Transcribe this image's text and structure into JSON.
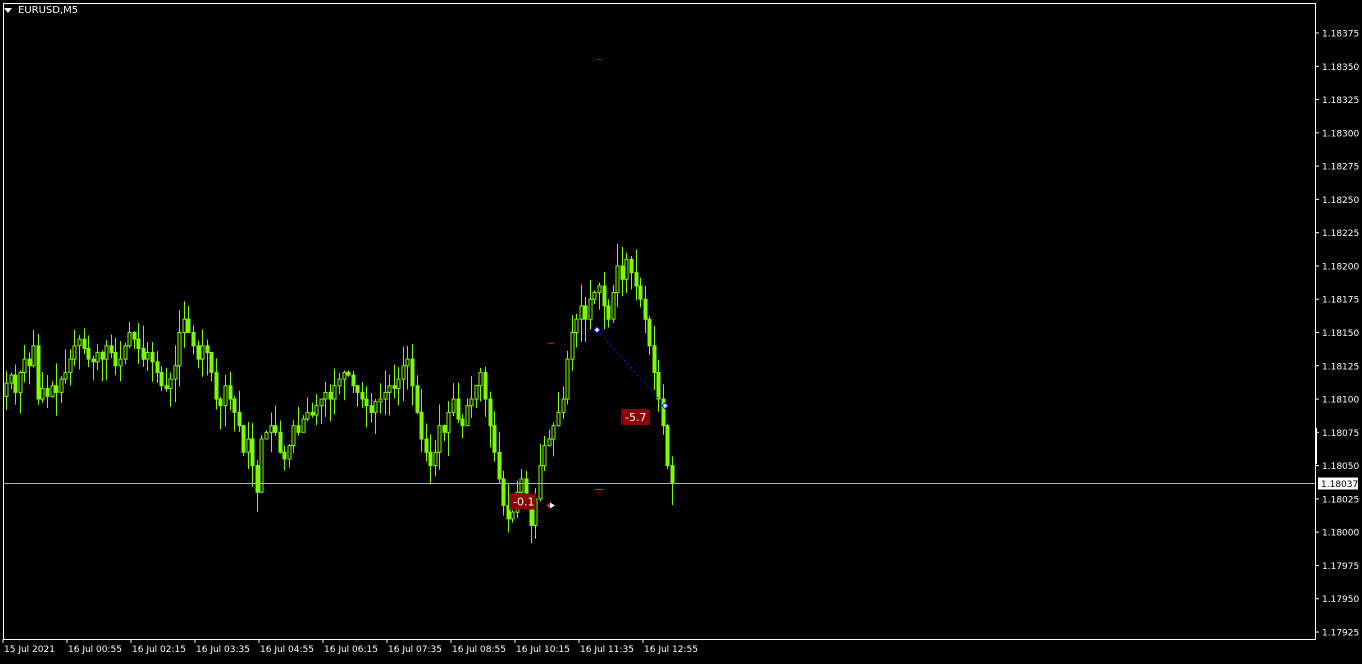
{
  "window": {
    "symbol_title": "EURUSD,M5"
  },
  "icons": {
    "menu": "triangle-down-icon"
  },
  "colors": {
    "background": "#000000",
    "frame": "#ffffff",
    "axis_text": "#ffffff",
    "bull_candle": "#7cfc00",
    "bear_candle": "#7cfc00",
    "bid_line": "#a8b4c0",
    "trade_line": "#1b1bff",
    "profit_badge": "#8b0000",
    "marker_red": "#ff2020"
  },
  "price_axis": {
    "min": 1.1791,
    "max": 1.1839,
    "ticks": [
      "1.18375",
      "1.18350",
      "1.18325",
      "1.18300",
      "1.18275",
      "1.18250",
      "1.18225",
      "1.18200",
      "1.18175",
      "1.18150",
      "1.18125",
      "1.18100",
      "1.18075",
      "1.18050",
      "1.18025",
      "1.18000",
      "1.17975",
      "1.17950",
      "1.17925"
    ],
    "current_price": "1.18037"
  },
  "time_axis": {
    "labels": [
      "15 Jul 2021",
      "16 Jul 00:55",
      "16 Jul 02:15",
      "16 Jul 03:35",
      "16 Jul 04:55",
      "16 Jul 06:15",
      "16 Jul 07:35",
      "16 Jul 08:55",
      "16 Jul 10:15",
      "16 Jul 11:35",
      "16 Jul 12:55"
    ]
  },
  "trades": [
    {
      "label": "-0.1"
    },
    {
      "label": "-5.7"
    }
  ],
  "chart_data": {
    "type": "candlestick",
    "symbol": "EURUSD",
    "timeframe": "M5",
    "ylim": [
      1.1791,
      1.1839
    ],
    "grid": false,
    "bars_approx_close": [
      1.18112,
      1.18118,
      1.18105,
      1.1812,
      1.1813,
      1.18125,
      1.1814,
      1.181,
      1.18108,
      1.18102,
      1.1811,
      1.18105,
      1.18115,
      1.1812,
      1.1813,
      1.1814,
      1.18145,
      1.18138,
      1.1813,
      1.18128,
      1.18135,
      1.1813,
      1.1814,
      1.18135,
      1.18125,
      1.1813,
      1.1814,
      1.1815,
      1.18145,
      1.18138,
      1.1813,
      1.18135,
      1.18128,
      1.1812,
      1.1811,
      1.18108,
      1.18115,
      1.18125,
      1.1815,
      1.1816,
      1.1815,
      1.1814,
      1.1813,
      1.1814,
      1.18135,
      1.1812,
      1.181,
      1.18095,
      1.1811,
      1.181,
      1.1809,
      1.1808,
      1.1806,
      1.1807,
      1.1805,
      1.1803,
      1.1807,
      1.18075,
      1.1808,
      1.18075,
      1.1806,
      1.18055,
      1.18065,
      1.1808,
      1.18075,
      1.18085,
      1.1809,
      1.18088,
      1.18095,
      1.181,
      1.18105,
      1.181,
      1.1811,
      1.18115,
      1.1812,
      1.18118,
      1.1811,
      1.18105,
      1.181,
      1.18095,
      1.1809,
      1.18098,
      1.181,
      1.18105,
      1.1811,
      1.18108,
      1.18115,
      1.18125,
      1.1813,
      1.1811,
      1.1809,
      1.1807,
      1.1806,
      1.1805,
      1.1806,
      1.1808,
      1.18075,
      1.1809,
      1.181,
      1.18085,
      1.1808,
      1.18095,
      1.181,
      1.1811,
      1.1812,
      1.181,
      1.1808,
      1.1806,
      1.1804,
      1.1802,
      1.1801,
      1.18015,
      1.1803,
      1.1804,
      1.1802,
      1.18005,
      1.18025,
      1.1805,
      1.18065,
      1.1807,
      1.1808,
      1.1809,
      1.181,
      1.1813,
      1.1815,
      1.1816,
      1.1817,
      1.1816,
      1.18175,
      1.1818,
      1.18185,
      1.1817,
      1.1816,
      1.1818,
      1.182,
      1.1819,
      1.18205,
      1.18195,
      1.18185,
      1.18175,
      1.1816,
      1.1814,
      1.1812,
      1.181,
      1.1808,
      1.1805,
      1.18037
    ],
    "trade_markers": [
      {
        "label": "-0.1",
        "entry_price": 1.1802,
        "kind": "closed"
      },
      {
        "label": "-5.7",
        "entry_price": 1.18152,
        "exit_price": 1.18095,
        "kind": "closed"
      }
    ]
  }
}
